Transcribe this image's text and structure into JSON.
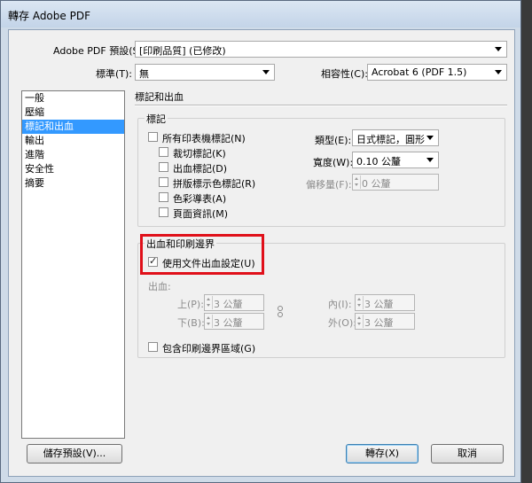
{
  "window": {
    "title": "轉存 Adobe PDF"
  },
  "header": {
    "preset_label": "Adobe PDF 預設(S):",
    "preset_value": "[印刷品質] (已修改)",
    "standard_label": "標準(T):",
    "standard_value": "無",
    "compat_label": "相容性(C):",
    "compat_value": "Acrobat 6 (PDF 1.5)"
  },
  "sidebar": {
    "items": [
      {
        "label": "一般"
      },
      {
        "label": "壓縮"
      },
      {
        "label": "標記和出血",
        "selected": true
      },
      {
        "label": "輸出"
      },
      {
        "label": "進階"
      },
      {
        "label": "安全性"
      },
      {
        "label": "摘要"
      }
    ]
  },
  "main": {
    "section_title": "標記和出血",
    "marks": {
      "group_title": "標記",
      "all_marks": "所有印表機標記(N)",
      "items": [
        {
          "label": "裁切標記(K)"
        },
        {
          "label": "出血標記(D)"
        },
        {
          "label": "拼版標示色標記(R)"
        },
        {
          "label": "色彩導表(A)"
        },
        {
          "label": "頁面資訊(M)"
        }
      ],
      "type_label": "類型(E):",
      "type_value": "日式標記，圓形",
      "weight_label": "寬度(W):",
      "weight_value": "0.10 公釐",
      "offset_label": "偏移量(F):",
      "offset_value": "0 公釐"
    },
    "bleed": {
      "group_title": "出血和印刷邊界",
      "use_doc_bleed": "使用文件出血設定(U)",
      "use_doc_bleed_checked": true,
      "bleed_label": "出血:",
      "top_label": "上(P):",
      "top_value": "3 公釐",
      "bottom_label": "下(B):",
      "bottom_value": "3 公釐",
      "inside_label": "內(I):",
      "inside_value": "3 公釐",
      "outside_label": "外(O):",
      "outside_value": "3 公釐",
      "include_slug": "包含印刷邊界區域(G)"
    }
  },
  "footer": {
    "save_preset": "儲存預設(V)...",
    "export": "轉存(X)",
    "cancel": "取消"
  },
  "colors": {
    "highlight": "#e0101a",
    "selection": "#3399ff"
  }
}
